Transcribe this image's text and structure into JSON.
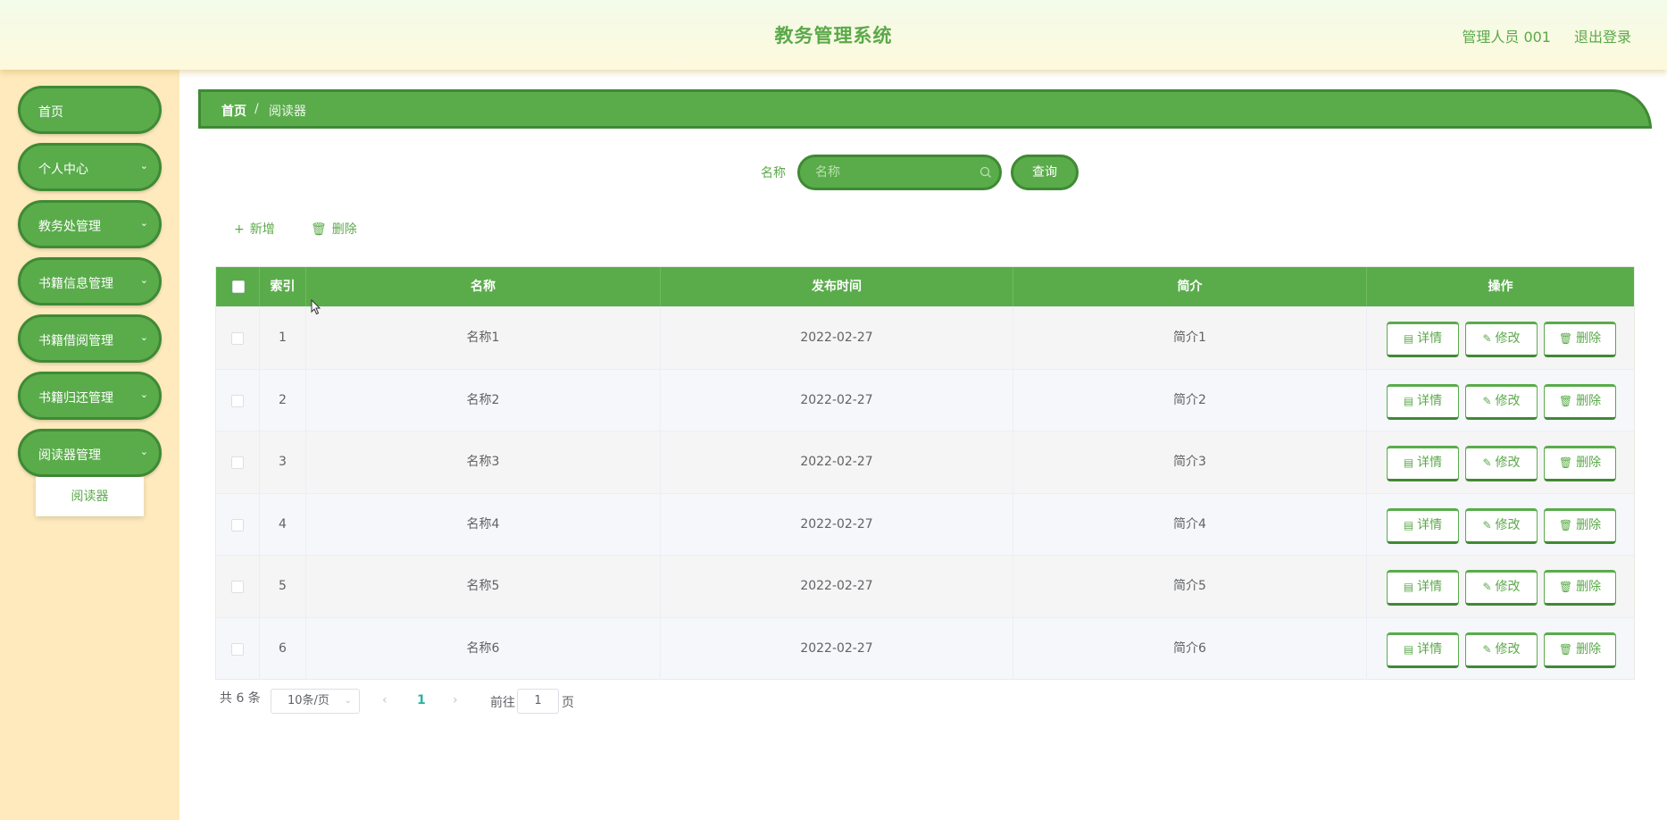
{
  "header": {
    "title": "教务管理系统",
    "user": "管理人员 001",
    "logout": "退出登录"
  },
  "sidebar": {
    "items": [
      {
        "label": "首页",
        "has_children": false
      },
      {
        "label": "个人中心",
        "has_children": true
      },
      {
        "label": "教务处管理",
        "has_children": true
      },
      {
        "label": "书籍信息管理",
        "has_children": true
      },
      {
        "label": "书籍借阅管理",
        "has_children": true
      },
      {
        "label": "书籍归还管理",
        "has_children": true
      },
      {
        "label": "阅读器管理",
        "has_children": true
      }
    ],
    "submenu": {
      "label": "阅读器"
    }
  },
  "breadcrumb": {
    "home": "首页",
    "separator": "/",
    "current": "阅读器"
  },
  "search": {
    "label": "名称",
    "placeholder": "名称",
    "value": "",
    "button": "查询"
  },
  "actions": {
    "add": "新增",
    "delete": "删除"
  },
  "table": {
    "columns": [
      "索引",
      "名称",
      "发布时间",
      "简介",
      "操作"
    ],
    "rows": [
      {
        "index": "1",
        "name": "名称1",
        "date": "2022-02-27",
        "intro": "简介1"
      },
      {
        "index": "2",
        "name": "名称2",
        "date": "2022-02-27",
        "intro": "简介2"
      },
      {
        "index": "3",
        "name": "名称3",
        "date": "2022-02-27",
        "intro": "简介3"
      },
      {
        "index": "4",
        "name": "名称4",
        "date": "2022-02-27",
        "intro": "简介4"
      },
      {
        "index": "5",
        "name": "名称5",
        "date": "2022-02-27",
        "intro": "简介5"
      },
      {
        "index": "6",
        "name": "名称6",
        "date": "2022-02-27",
        "intro": "简介6"
      }
    ],
    "row_buttons": {
      "detail": "详情",
      "edit": "修改",
      "delete": "删除"
    }
  },
  "pagination": {
    "total": "共 6 条",
    "page_size": "10条/页",
    "current_page": "1",
    "goto_prefix": "前往",
    "goto_value": "1",
    "goto_suffix": "页"
  },
  "colors": {
    "primary": "#5aac4b",
    "primary_dark": "#3f8a34",
    "sidebar_bg": "#feeabd",
    "header_text": "#5ba94a"
  }
}
